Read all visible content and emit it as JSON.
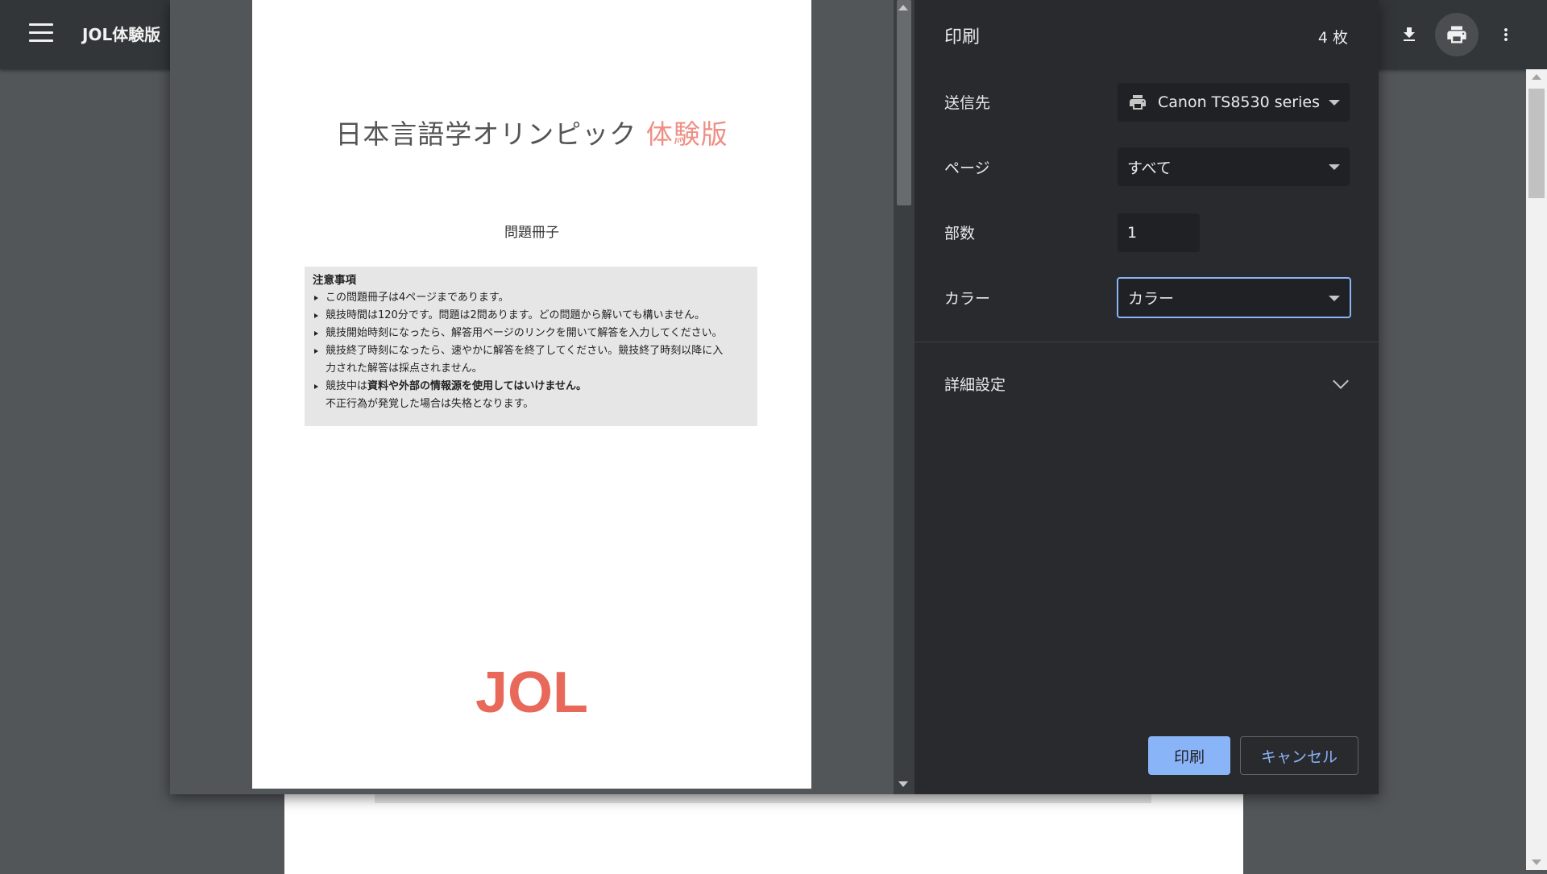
{
  "viewer": {
    "title": "JOL体験版",
    "icons": [
      "menu-icon",
      "download-icon",
      "print-icon",
      "more-vert-icon"
    ]
  },
  "preview": {
    "doc_title_main": "日本言語学オリンピック",
    "doc_title_accent": "体験版",
    "subtitle": "問題冊子",
    "notice_heading": "注意事項",
    "notice_items": [
      "この問題冊子は4ページまであります。",
      "競技時間は120分です。問題は2問あります。どの問題から解いても構いません。",
      "競技開始時刻になったら、解答用ページのリンクを開いて解答を入力してください。",
      "競技終了時刻になったら、速やかに解答を終了してください。競技終了時刻以降に入",
      "力された解答は採点されません。",
      "競技中は",
      "資料や外部の情報源を使用してはいけません。",
      "不正行為が発覚した場合は失格となります。"
    ],
    "logo_text": "JOL",
    "accent_color": "#ef8f86",
    "logo_color": "#e8685a"
  },
  "print": {
    "title": "印刷",
    "sheet_count": "4 枚",
    "destination_label": "送信先",
    "destination_value": "Canon TS8530 series",
    "pages_label": "ページ",
    "pages_value": "すべて",
    "copies_label": "部数",
    "copies_value": "1",
    "color_label": "カラー",
    "color_value": "カラー",
    "advanced_label": "詳細設定",
    "print_button": "印刷",
    "cancel_button": "キャンセル",
    "accent": "#8ab4f8"
  }
}
